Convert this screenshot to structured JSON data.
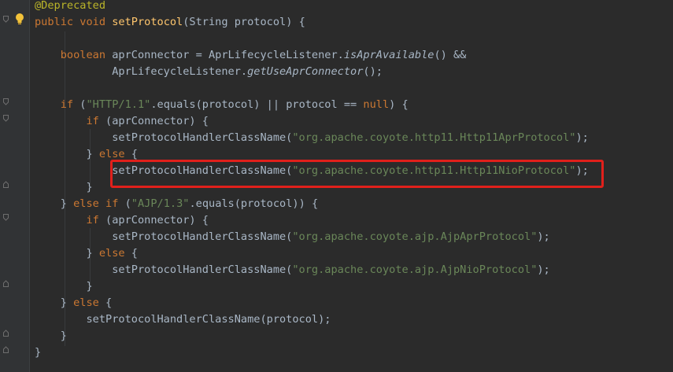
{
  "editor": {
    "language": "java",
    "highlight_color": "#e0201b",
    "lines": [
      {
        "tokens": [
          {
            "t": "@Deprecated",
            "c": "annotation"
          }
        ]
      },
      {
        "tokens": [
          {
            "t": "public void ",
            "c": "keyword"
          },
          {
            "t": "setProtocol",
            "c": "method-decl"
          },
          {
            "t": "(String protocol) {",
            "c": "plain"
          }
        ]
      },
      {
        "tokens": []
      },
      {
        "tokens": [
          {
            "t": "    boolean ",
            "c": "keyword"
          },
          {
            "t": "aprConnector = AprLifecycleListener.",
            "c": "plain"
          },
          {
            "t": "isAprAvailable",
            "c": "static-italic"
          },
          {
            "t": "() &&",
            "c": "plain"
          }
        ]
      },
      {
        "tokens": [
          {
            "t": "            AprLifecycleListener.",
            "c": "plain"
          },
          {
            "t": "getUseAprConnector",
            "c": "static-italic"
          },
          {
            "t": "();",
            "c": "plain"
          }
        ]
      },
      {
        "tokens": []
      },
      {
        "tokens": [
          {
            "t": "    if ",
            "c": "keyword"
          },
          {
            "t": "(",
            "c": "plain"
          },
          {
            "t": "\"HTTP/1.1\"",
            "c": "string"
          },
          {
            "t": ".equals(protocol) || protocol == ",
            "c": "plain"
          },
          {
            "t": "null",
            "c": "keyword"
          },
          {
            "t": ") {",
            "c": "plain"
          }
        ]
      },
      {
        "tokens": [
          {
            "t": "        if ",
            "c": "keyword"
          },
          {
            "t": "(aprConnector) {",
            "c": "plain"
          }
        ]
      },
      {
        "tokens": [
          {
            "t": "            setProtocolHandlerClassName(",
            "c": "plain"
          },
          {
            "t": "\"org.apache.coyote.http11.Http11AprProtocol\"",
            "c": "string"
          },
          {
            "t": ");",
            "c": "plain"
          }
        ]
      },
      {
        "tokens": [
          {
            "t": "        } ",
            "c": "plain"
          },
          {
            "t": "else ",
            "c": "keyword"
          },
          {
            "t": "{",
            "c": "plain"
          }
        ]
      },
      {
        "tokens": [
          {
            "t": "            setProtocolHandlerClassName(",
            "c": "plain"
          },
          {
            "t": "\"org.apache.coyote.http11.Http11NioProtocol\"",
            "c": "string"
          },
          {
            "t": ");",
            "c": "plain"
          }
        ]
      },
      {
        "tokens": [
          {
            "t": "        }",
            "c": "plain"
          }
        ]
      },
      {
        "tokens": [
          {
            "t": "    } ",
            "c": "plain"
          },
          {
            "t": "else if ",
            "c": "keyword"
          },
          {
            "t": "(",
            "c": "plain"
          },
          {
            "t": "\"AJP/1.3\"",
            "c": "string"
          },
          {
            "t": ".equals(protocol)) {",
            "c": "plain"
          }
        ]
      },
      {
        "tokens": [
          {
            "t": "        if ",
            "c": "keyword"
          },
          {
            "t": "(aprConnector) {",
            "c": "plain"
          }
        ]
      },
      {
        "tokens": [
          {
            "t": "            setProtocolHandlerClassName(",
            "c": "plain"
          },
          {
            "t": "\"org.apache.coyote.ajp.AjpAprProtocol\"",
            "c": "string"
          },
          {
            "t": ");",
            "c": "plain"
          }
        ]
      },
      {
        "tokens": [
          {
            "t": "        } ",
            "c": "plain"
          },
          {
            "t": "else ",
            "c": "keyword"
          },
          {
            "t": "{",
            "c": "plain"
          }
        ]
      },
      {
        "tokens": [
          {
            "t": "            setProtocolHandlerClassName(",
            "c": "plain"
          },
          {
            "t": "\"org.apache.coyote.ajp.AjpNioProtocol\"",
            "c": "string"
          },
          {
            "t": ");",
            "c": "plain"
          }
        ]
      },
      {
        "tokens": [
          {
            "t": "        }",
            "c": "plain"
          }
        ]
      },
      {
        "tokens": [
          {
            "t": "    } ",
            "c": "plain"
          },
          {
            "t": "else ",
            "c": "keyword"
          },
          {
            "t": "{",
            "c": "plain"
          }
        ]
      },
      {
        "tokens": [
          {
            "t": "        setProtocolHandlerClassName(protocol);",
            "c": "plain"
          }
        ]
      },
      {
        "tokens": [
          {
            "t": "    }",
            "c": "plain"
          }
        ]
      },
      {
        "tokens": [
          {
            "t": "}",
            "c": "plain"
          }
        ]
      }
    ]
  }
}
